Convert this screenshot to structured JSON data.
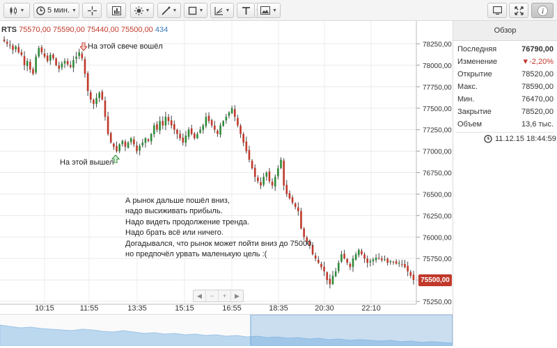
{
  "toolbar": {
    "timeframe": "5 мин."
  },
  "quote": {
    "symbol": "RTS",
    "open": "75570,00",
    "high": "75590,00",
    "low": "75440,00",
    "close": "75500,00",
    "volume": "434"
  },
  "annotations": {
    "entry": "На этой свече вошёл",
    "exit": "На этой вышел",
    "comment": [
      "А рынок дальше пошёл вниз,",
      "надо высиживать прибыль.",
      "Надо видеть продолжение тренда.",
      "Надо брать всё или ничего.",
      "Догадывался, что рынок может пойти вниз до 75000,",
      "но предпочёл урвать маленькую цель :("
    ]
  },
  "current_price": "75500,00",
  "panel": {
    "title": "Обзор",
    "rows": [
      {
        "label": "Последняя",
        "value": "76790,00"
      },
      {
        "label": "Изменение",
        "value": "▼-2,20%"
      },
      {
        "label": "Открытие",
        "value": "78520,00"
      },
      {
        "label": "Макс.",
        "value": "78590,00"
      },
      {
        "label": "Мин.",
        "value": "76470,00"
      },
      {
        "label": "Закрытие",
        "value": "78520,00"
      },
      {
        "label": "Объем",
        "value": "13,6 тыс."
      }
    ],
    "timestamp": "11.12.15 18:44:59"
  },
  "colors": {
    "up": "#2e8b3a",
    "down": "#c0392b",
    "navigator_fill": "#bcd8ef",
    "navigator_selected": "#6fa8dc"
  },
  "chart_data": {
    "type": "candlestick",
    "y_ticks": [
      "78250,00",
      "78000,00",
      "77750,00",
      "77500,00",
      "77250,00",
      "77000,00",
      "76750,00",
      "76500,00",
      "76250,00",
      "76000,00",
      "75750,00",
      "75500,00",
      "75250,00"
    ],
    "x_ticks": [
      "10:15",
      "11:55",
      "13:35",
      "15:15",
      "16:55",
      "18:35",
      "20:30",
      "22:10"
    ],
    "ylim": [
      75200,
      78400
    ],
    "close_path": [
      78280,
      78250,
      78230,
      78180,
      78220,
      78150,
      78120,
      78000,
      78050,
      77950,
      77900,
      78100,
      78200,
      78150,
      78100,
      78050,
      78120,
      78080,
      78000,
      77960,
      78020,
      78050,
      78010,
      77980,
      78060,
      78100,
      78150,
      78080,
      77900,
      77700,
      77600,
      77550,
      77620,
      77680,
      77600,
      77400,
      77200,
      77100,
      77050,
      77000,
      77080,
      77120,
      77050,
      77100,
      77150,
      77080,
      77000,
      77060,
      77100,
      77150,
      77120,
      77200,
      77300,
      77250,
      77350,
      77300,
      77400,
      77350,
      77300,
      77250,
      77200,
      77150,
      77100,
      77180,
      77250,
      77200,
      77150,
      77200,
      77250,
      77300,
      77400,
      77350,
      77300,
      77250,
      77200,
      77300,
      77350,
      77400,
      77450,
      77500,
      77400,
      77300,
      77200,
      77100,
      77000,
      76900,
      76800,
      76700,
      76650,
      76600,
      76700,
      76750,
      76650,
      76600,
      76700,
      76800,
      76900,
      76600,
      76500,
      76450,
      76400,
      76350,
      76300,
      76100,
      76000,
      75950,
      75900,
      75800,
      75750,
      75700,
      75650,
      75600,
      75500,
      75450,
      75550,
      75600,
      75700,
      75800,
      75750,
      75700,
      75650,
      75750,
      75800,
      75850,
      75800,
      75750,
      75700,
      75720,
      75740,
      75760,
      75750,
      75730,
      75740,
      75700,
      75720,
      75710,
      75690,
      75700,
      75680,
      75650,
      75600,
      75550,
      75500
    ]
  }
}
